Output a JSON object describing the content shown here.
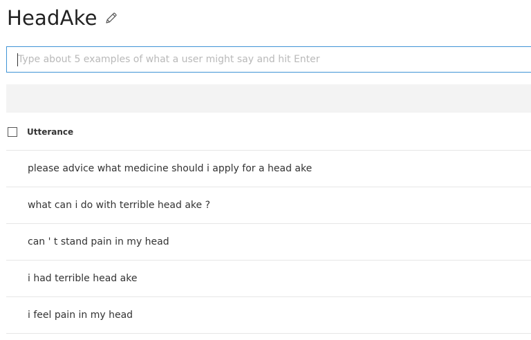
{
  "header": {
    "title": "HeadAke",
    "edit_icon": "pencil-icon"
  },
  "search": {
    "placeholder": "Type about 5 examples of what a user might say and hit Enter",
    "value": ""
  },
  "table": {
    "column_header": "Utterance",
    "rows": [
      "please advice what medicine should i apply for a head ake",
      "what can i do with terrible head ake ?",
      "can ' t stand pain in my head",
      "i had terrible head ake",
      "i feel pain in my head"
    ]
  },
  "colors": {
    "input_border": "#3f93d6",
    "toolbar_bg": "#f3f3f3",
    "divider": "#e6e6e6",
    "placeholder": "#b9b9b9"
  }
}
